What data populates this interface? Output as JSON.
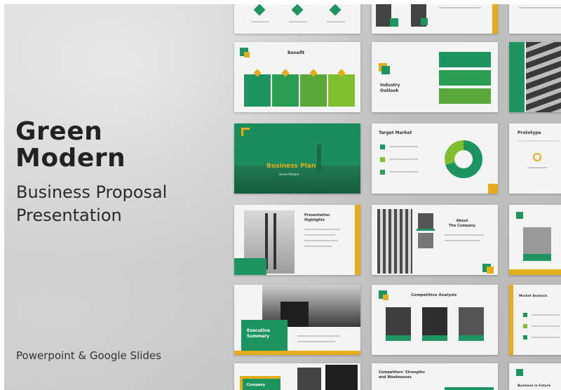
{
  "hero": {
    "title_line1": "Green",
    "title_line2": "Modern",
    "subtitle_line1": "Business Proposal",
    "subtitle_line2": "Presentation",
    "formats": "Powerpoint & Google Slides"
  },
  "colors": {
    "green": "#1e9560",
    "light_green": "#7fbf2f",
    "yellow": "#e3ad1c",
    "background": "#c8c8c8"
  },
  "slides": {
    "benefit": {
      "title": "Benefit"
    },
    "industry": {
      "title_line1": "Industry",
      "title_line2": "Outlook"
    },
    "business_plan": {
      "title": "Business Plan",
      "subtitle": "Green Modern"
    },
    "target_market": {
      "title": "Target Market"
    },
    "prototype": {
      "title": "Prototype"
    },
    "highlights": {
      "title_line1": "Presentation",
      "title_line2": "Highlights"
    },
    "about": {
      "title_line1": "About",
      "title_line2": "The Company"
    },
    "executive": {
      "title_line1": "Executive",
      "title_line2": "Summary"
    },
    "competitive": {
      "title": "Competitive Analysis"
    },
    "market_analysis": {
      "title": "Market Analysis"
    },
    "strengths": {
      "title_line1": "Competitors' Strengths",
      "title_line2": "and Weaknesses"
    },
    "company": {
      "title": "Company"
    },
    "business_in": {
      "title": "Business in Future"
    }
  }
}
